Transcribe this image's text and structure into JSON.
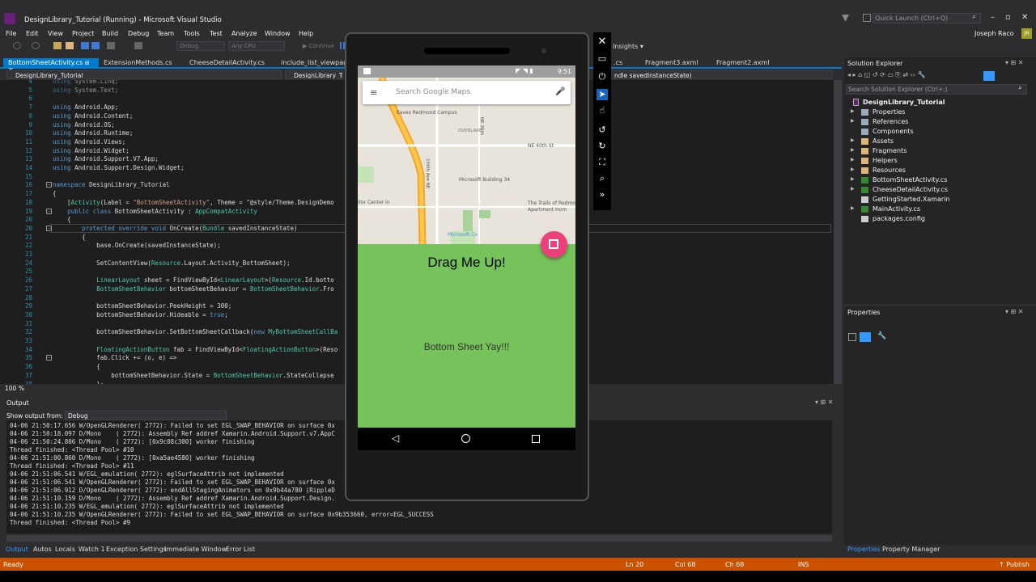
{
  "window": {
    "title": "DesignLibrary_Tutorial (Running) - Microsoft Visual Studio",
    "quick_launch": "Quick Launch (Ctrl+Q)",
    "user": "Joseph Raco",
    "user_initials": "JR"
  },
  "menu": [
    "File",
    "Edit",
    "View",
    "Project",
    "Build",
    "Debug",
    "Team",
    "Tools",
    "Test",
    "Analyze",
    "Window",
    "Help"
  ],
  "toolbar": {
    "config": "Debug",
    "platform": "Any CPU",
    "continue_label": "Continue",
    "insights": "Insights"
  },
  "tabs": [
    "BottomSheetActivity.cs",
    "ExtensionMethods.cs",
    "CheeseDetailActivity.cs",
    "include_list_viewpager",
    ".cs",
    "Fragment3.axml",
    "Fragment2.axml"
  ],
  "navbar": {
    "project": "DesignLibrary_Tutorial",
    "class": "DesignLibrary_Tuto",
    "member": "ndle savedInstanceState)"
  },
  "code_lines": [
    {
      "n": "4",
      "t": "using System.Linq;"
    },
    {
      "n": "5",
      "t": "using System.Text;"
    },
    {
      "n": "6",
      "t": ""
    },
    {
      "n": "7",
      "t": "using Android.App;"
    },
    {
      "n": "8",
      "t": "using Android.Content;"
    },
    {
      "n": "9",
      "t": "using Android.OS;"
    },
    {
      "n": "10",
      "t": "using Android.Runtime;"
    },
    {
      "n": "11",
      "t": "using Android.Views;"
    },
    {
      "n": "12",
      "t": "using Android.Widget;"
    },
    {
      "n": "13",
      "t": "using Android.Support.V7.App;"
    },
    {
      "n": "14",
      "t": "using Android.Support.Design.Widget;"
    },
    {
      "n": "15",
      "t": ""
    },
    {
      "n": "16",
      "t": "namespace DesignLibrary_Tutorial"
    },
    {
      "n": "17",
      "t": "{"
    },
    {
      "n": "18",
      "t": "    [Activity(Label = \"BottomSheetActivity\", Theme = \"@style/Theme.DesignDemo"
    },
    {
      "n": "19",
      "t": "    public class BottomSheetActivity : AppCompatActivity"
    },
    {
      "n": "20",
      "t": "    {"
    },
    {
      "n": "20",
      "t": "        protected override void OnCreate(Bundle savedInstanceState)"
    },
    {
      "n": "21",
      "t": "        {"
    },
    {
      "n": "22",
      "t": "            base.OnCreate(savedInstanceState);"
    },
    {
      "n": "23",
      "t": ""
    },
    {
      "n": "24",
      "t": "            SetContentView(Resource.Layout.Activity_BottomSheet);"
    },
    {
      "n": "25",
      "t": ""
    },
    {
      "n": "26",
      "t": "            LinearLayout sheet = FindViewById<LinearLayout>(Resource.Id.botto"
    },
    {
      "n": "27",
      "t": "            BottomSheetBehavior bottomSheetBehavior = BottomSheetBehavior.Fro"
    },
    {
      "n": "28",
      "t": ""
    },
    {
      "n": "29",
      "t": "            bottomSheetBehavior.PeekHeight = 300;"
    },
    {
      "n": "30",
      "t": "            bottomSheetBehavior.Hideable = true;"
    },
    {
      "n": "31",
      "t": ""
    },
    {
      "n": "32",
      "t": "            bottomSheetBehavior.SetBottomSheetCallback(new MyBottomSheetCallBa"
    },
    {
      "n": "33",
      "t": ""
    },
    {
      "n": "34",
      "t": "            FloatingActionButton fab = FindViewById<FloatingActionButton>(Reso"
    },
    {
      "n": "35",
      "t": "            fab.Click += (o, e) =>"
    },
    {
      "n": "36",
      "t": "            {"
    },
    {
      "n": "37",
      "t": "                bottomSheetBehavior.State = BottomSheetBehavior.StateCollapse"
    },
    {
      "n": "38",
      "t": "            };"
    }
  ],
  "zoom": "100 %",
  "output": {
    "title": "Output",
    "show_from_label": "Show output from:",
    "source": "Debug",
    "lines": [
      "04-06 21:50:17.656 W/OpenGLRenderer( 2772): Failed to set EGL_SWAP_BEHAVIOR on surface 0x",
      "04-06 21:50:18.097 D/Mono    ( 2772): Assembly Ref addref Xamarin.Android.Support.v7.AppC",
      "04-06 21:50:24.806 D/Mono    ( 2772): [0x9c08c300] worker finishing",
      "Thread finished: <Thread Pool> #10",
      "04-06 21:51:00.860 D/Mono    ( 2772): [0xa5ae4580] worker finishing",
      "Thread finished: <Thread Pool> #11",
      "04-06 21:51:06.541 W/EGL_emulation( 2772): eglSurfaceAttrib not implemented",
      "04-06 21:51:06.541 W/OpenGLRenderer( 2772): Failed to set EGL_SWAP_BEHAVIOR on surface 0x",
      "04-06 21:51:06.912 D/OpenGLRenderer( 2772): endAllStagingAnimators on 0x9b44a780 (RippleD",
      "04-06 21:51:10.159 D/Mono    ( 2772): Assembly Ref addref Xamarin.Android.Support.Design.",
      "04-06 21:51:10.235 W/EGL_emulation( 2772): eglSurfaceAttrib not implemented",
      "04-06 21:51:10.235 W/OpenGLRenderer( 2772): Failed to set EGL_SWAP_BEHAVIOR on surface 0x9b353660, error=EGL_SUCCESS",
      "Thread finished: <Thread Pool> #9"
    ]
  },
  "bottom_tabs": [
    "Output",
    "Autos",
    "Locals",
    "Watch 1",
    "Exception Settings",
    "Immediate Window",
    "Error List"
  ],
  "right_bottom_tabs": [
    "Properties",
    "Property Manager"
  ],
  "status": {
    "ready": "Ready",
    "ln": "Ln 20",
    "col": "Col 68",
    "ch": "Ch 68",
    "ins": "INS",
    "publish": "Publish"
  },
  "solution_explorer": {
    "title": "Solution Explorer",
    "search": "Search Solution Explorer (Ctrl+;)",
    "root": "DesignLibrary_Tutorial",
    "items": [
      "Properties",
      "References",
      "Components",
      "Assets",
      "Fragments",
      "Helpers",
      "Resources",
      "BottomSheetActivity.cs",
      "CheeseDetailActivity.cs",
      "GettingStarted.Xamarin",
      "MainActivity.cs",
      "packages.config"
    ]
  },
  "properties": {
    "title": "Properties"
  },
  "phone": {
    "time": "9:51",
    "search_placeholder": "Search Google Maps",
    "sheet_title": "Drag Me Up!",
    "sheet_body": "Bottom Sheet Yay!!!",
    "map_labels": [
      "Eaves Redmond Campus",
      "OVERLAKE",
      "NE 40th St",
      "Microsoft Building 34",
      "The Trails of Redmo",
      "Apartment Hom",
      "itor Center in",
      "Microsoft Co",
      "156th Ave NE",
      "NE 36th"
    ]
  },
  "colors": {
    "accent": "#007acc",
    "status": "#ca5100",
    "sheet": "#77c35b",
    "fab": "#ec407a"
  }
}
